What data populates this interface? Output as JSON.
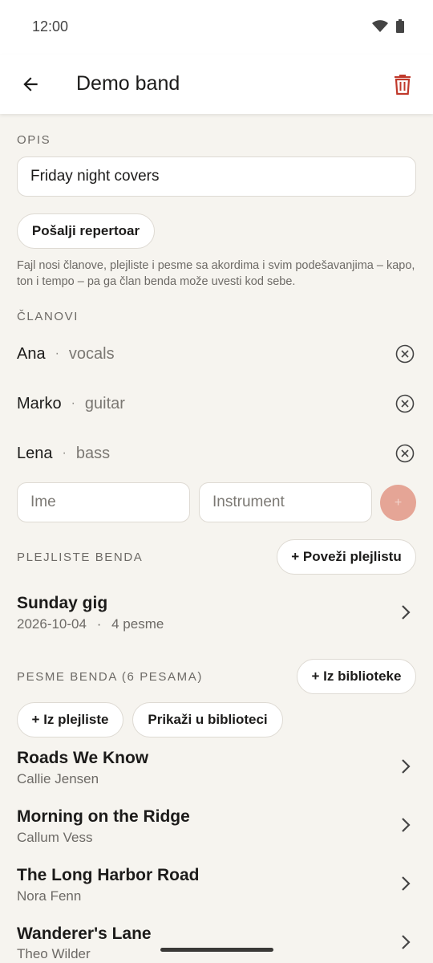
{
  "status": {
    "time": "12:00"
  },
  "appbar": {
    "title": "Demo band"
  },
  "description": {
    "label": "OPIS",
    "value": "Friday night covers"
  },
  "send_button": "Pošalji repertoar",
  "hint": "Fajl nosi članove, plejliste i pesme sa akordima i svim podešavanjima – kapo, ton i tempo – pa ga član benda može uvesti kod sebe.",
  "members": {
    "label": "ČLANOVI",
    "separator": "·",
    "items": [
      {
        "name": "Ana",
        "instrument": "vocals"
      },
      {
        "name": "Marko",
        "instrument": "guitar"
      },
      {
        "name": "Lena",
        "instrument": "bass"
      }
    ],
    "name_placeholder": "Ime",
    "instrument_placeholder": "Instrument",
    "add_symbol": "+"
  },
  "playlists": {
    "label": "PLEJLISTE BENDA",
    "link_button": "+ Poveži plejlistu",
    "items": [
      {
        "title": "Sunday gig",
        "date": "2026-10-04",
        "separator": "·",
        "count": "4 pesme"
      }
    ]
  },
  "songs": {
    "label": "PESME BENDA (6 PESAMA)",
    "from_library_button": "+ Iz biblioteke",
    "from_playlist_button": "+ Iz plejliste",
    "show_in_library_button": "Prikaži u biblioteci",
    "items": [
      {
        "title": "Roads We Know",
        "artist": "Callie Jensen"
      },
      {
        "title": "Morning on the Ridge",
        "artist": "Callum Vess"
      },
      {
        "title": "The Long Harbor Road",
        "artist": "Nora Fenn"
      },
      {
        "title": "Wanderer's Lane",
        "artist": "Theo Wilder"
      }
    ]
  },
  "colors": {
    "accent": "#c0392b",
    "add_button": "#e5a596",
    "background": "#f6f4ef"
  }
}
